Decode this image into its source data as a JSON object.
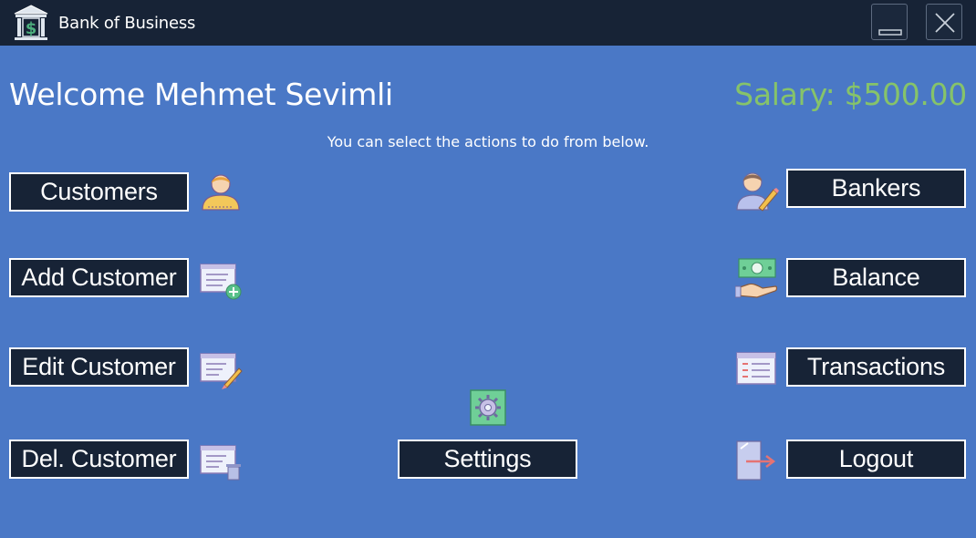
{
  "window": {
    "title": "Bank of Business",
    "logo_icon": "bank-dollar-icon",
    "minimize_icon": "minimize-icon",
    "close_icon": "close-icon"
  },
  "header": {
    "welcome": "Welcome Mehmet Sevimli",
    "salary": "Salary: $500.00",
    "hint": "You can select the actions to do from below."
  },
  "actions": {
    "customers": "Customers",
    "add_customer": "Add Customer",
    "edit_customer": "Edit Customer",
    "delete_customer": "Del. Customer",
    "bankers": "Bankers",
    "balance": "Balance",
    "transactions": "Transactions",
    "logout": "Logout",
    "settings": "Settings"
  },
  "colors": {
    "background": "#4a78c6",
    "titlebar": "#172336",
    "button_bg": "#172336",
    "salary": "#86c36a"
  }
}
